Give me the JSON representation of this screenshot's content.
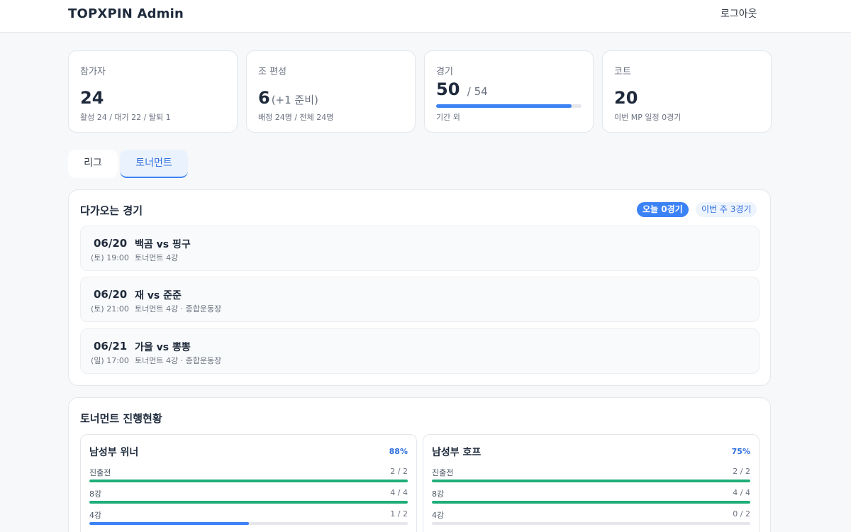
{
  "header": {
    "title": "TOPXPIN Admin",
    "logout_label": "로그아웃"
  },
  "stats": [
    {
      "label": "참가자",
      "value": "24",
      "extra": "",
      "sub": "활성 24 / 대기 22 / 탈퇴 1"
    },
    {
      "label": "조 편성",
      "value": "6",
      "extra": "(+1 준비)",
      "sub": "배정 24명 / 전체 24명"
    },
    {
      "label": "경기",
      "value": "50",
      "extra": "/ 54",
      "sub": "기간 외",
      "progress": 0.93
    },
    {
      "label": "코트",
      "value": "20",
      "extra": "",
      "sub": "이번 MP 일정 0경기"
    }
  ],
  "tabs": {
    "league": "리그",
    "tournament": "토너먼트",
    "active": "tournament"
  },
  "upcoming": {
    "title": "다가오는 경기",
    "badge_today": "오늘 0경기",
    "badge_week": "이번 주 3경기",
    "matches": [
      {
        "date": "06/20",
        "time": "(토) 19:00",
        "title": "백곰 vs 핑구",
        "meta": "토너먼트 4강"
      },
      {
        "date": "06/20",
        "time": "(토) 21:00",
        "title": "재 vs 준준",
        "meta": "토너먼트 4강 · 종합운동장"
      },
      {
        "date": "06/21",
        "time": "(일) 17:00",
        "title": "가을 vs 뽕뽕",
        "meta": "토너먼트 4강 · 종합운동장"
      }
    ]
  },
  "progress": {
    "title": "토너먼트 진행현황",
    "brackets": [
      {
        "name": "남성부 위너",
        "percent": "88%",
        "rounds": [
          {
            "label": "진출전",
            "count": "2 / 2",
            "fraction": 1.0,
            "color": "#1fae7a"
          },
          {
            "label": "8강",
            "count": "4 / 4",
            "fraction": 1.0,
            "color": "#1fae7a"
          },
          {
            "label": "4강",
            "count": "1 / 2",
            "fraction": 0.5,
            "color": "#3b82f6"
          }
        ]
      },
      {
        "name": "남성부 호프",
        "percent": "75%",
        "rounds": [
          {
            "label": "진출전",
            "count": "2 / 2",
            "fraction": 1.0,
            "color": "#1fae7a"
          },
          {
            "label": "8강",
            "count": "4 / 4",
            "fraction": 1.0,
            "color": "#1fae7a"
          },
          {
            "label": "4강",
            "count": "0 / 2",
            "fraction": 0.0,
            "color": "#3b82f6"
          }
        ]
      }
    ]
  }
}
